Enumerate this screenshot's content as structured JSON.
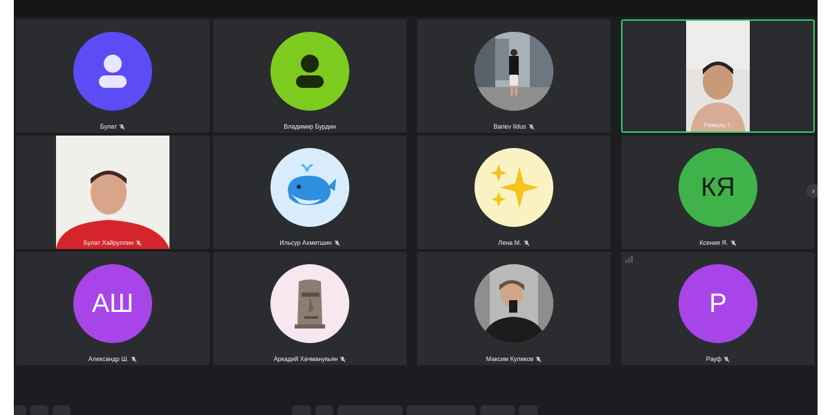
{
  "tiles": [
    {
      "name": "Булат",
      "avatar_color": "#5b4cf5",
      "muted": true
    },
    {
      "name": "Владимир Бурдин",
      "avatar_color": "#7ecb1f",
      "muted": false
    },
    {
      "name": "Bariev Ildus",
      "muted": true
    },
    {
      "name": "Рамиль Г.",
      "active_speaker": true,
      "muted": false
    },
    {
      "name": "Булат Хайруллин",
      "muted": true
    },
    {
      "name": "Ильсур Ахметшин",
      "avatar_color": "#d8ecfb",
      "muted": true
    },
    {
      "name": "Лена М.",
      "avatar_color": "#fbf2c4",
      "muted": true
    },
    {
      "name": "Ксения Я.",
      "initials": "КЯ",
      "avatar_color": "#3fb34a",
      "muted": true
    },
    {
      "name": "Александр Ш.",
      "initials": "АШ",
      "avatar_color": "#a845e8",
      "muted": true
    },
    {
      "name": "Аркадий Хачманукьян",
      "avatar_color": "#f6e8ee",
      "muted": true
    },
    {
      "name": "Максим Куликов",
      "muted": true
    },
    {
      "name": "Рауф",
      "initials": "Р",
      "avatar_color": "#a845e8",
      "muted": true
    }
  ],
  "colors": {
    "background": "#1c1d20",
    "tile": "#2a2c30",
    "active_border": "#35d06a"
  },
  "icons": [
    "user-icon",
    "mic-off-icon",
    "whale-emoji-icon",
    "sparkles-emoji-icon",
    "moai-emoji-icon",
    "chevron-right-icon"
  ]
}
